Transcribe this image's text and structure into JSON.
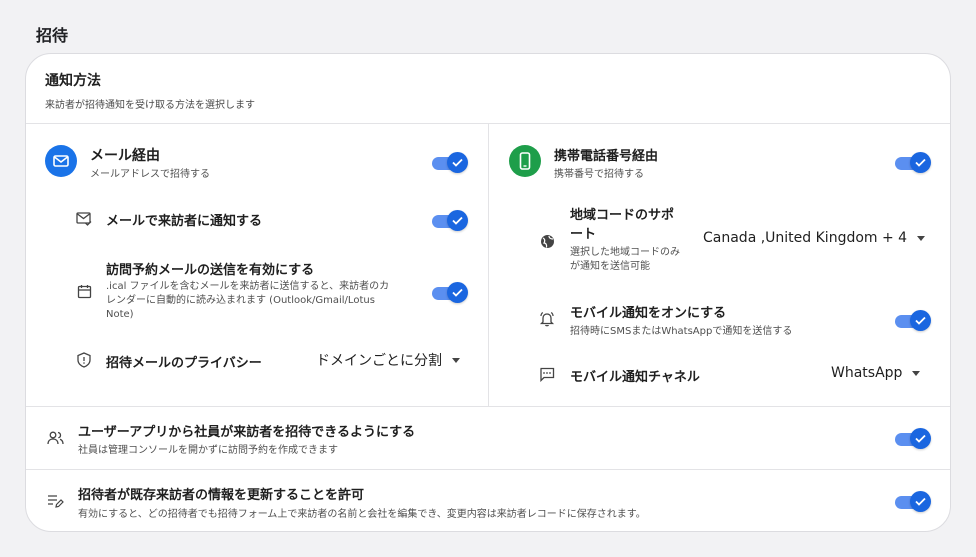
{
  "page_title": "招待",
  "card": {
    "title": "通知方法",
    "subtitle": "来訪者が招待通知を受け取る方法を選択します"
  },
  "email": {
    "title": "メール経由",
    "subtitle": "メールアドレスで招待する",
    "enabled": true,
    "notify_title": "メールで来訪者に通知する",
    "notify_enabled": true,
    "ical_title": "訪問予約メールの送信を有効にする",
    "ical_desc_line1": ".ical ファイルを含むメールを来訪者に送信すると、来訪者のカ",
    "ical_desc_line2": "レンダーに自動的に読み込まれます (Outlook/Gmail/Lotus",
    "ical_desc_line3": "Note)",
    "ical_enabled": true,
    "privacy_title": "招待メールのプライバシー",
    "privacy_value": "ドメインごとに分割"
  },
  "phone": {
    "title": "携帯電話番号経由",
    "subtitle": "携帯番号で招待する",
    "enabled": true,
    "region_title_line1": "地域コードのサポ",
    "region_title_line2": "ート",
    "region_desc_line1": "選択した地域コードのみ",
    "region_desc_line2": "が通知を送信可能",
    "region_value": "Canada ,United Kingdom + 4",
    "mobile_notify_title": "モバイル通知をオンにする",
    "mobile_notify_desc": "招待時にSMSまたはWhatsAppで通知を送信する",
    "mobile_notify_enabled": true,
    "channel_title": "モバイル通知チャネル",
    "channel_value": "WhatsApp"
  },
  "user_app": {
    "title": "ユーザーアプリから社員が来訪者を招待できるようにする",
    "subtitle": "社員は管理コンソールを開かずに訪問予約を作成できます",
    "enabled": true
  },
  "update_info": {
    "title": "招待者が既存来訪者の情報を更新することを許可",
    "subtitle": "有効にすると、どの招待者でも招待フォーム上で来訪者の名前と会社を編集でき、変更内容は来訪者レコードに保存されます。",
    "enabled": true
  },
  "colors": {
    "accent": "#1a66e0",
    "email_icon_bg": "#1a73e8",
    "phone_icon_bg": "#1e9e4a"
  }
}
